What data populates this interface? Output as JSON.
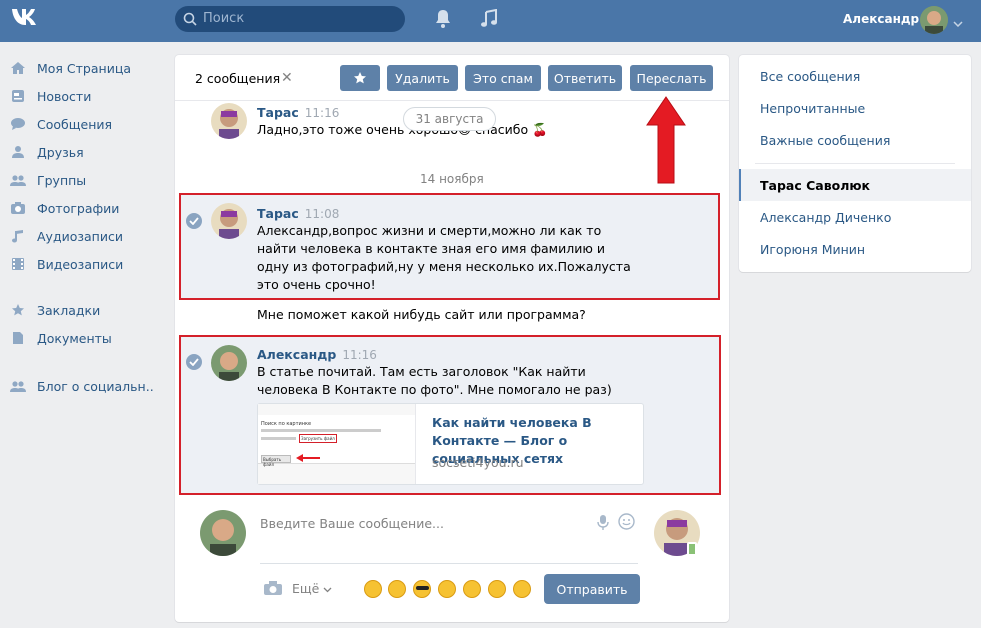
{
  "header": {
    "search_placeholder": "Поиск",
    "user_name": "Александр"
  },
  "sidebar": {
    "items": [
      {
        "label": "Моя Страница",
        "icon": "home-icon"
      },
      {
        "label": "Новости",
        "icon": "news-icon"
      },
      {
        "label": "Сообщения",
        "icon": "messages-icon"
      },
      {
        "label": "Друзья",
        "icon": "friends-icon"
      },
      {
        "label": "Группы",
        "icon": "groups-icon"
      },
      {
        "label": "Фотографии",
        "icon": "camera-icon"
      },
      {
        "label": "Аудиозаписи",
        "icon": "music-icon"
      },
      {
        "label": "Видеозаписи",
        "icon": "video-icon"
      },
      {
        "label": "Закладки",
        "icon": "star-icon"
      },
      {
        "label": "Документы",
        "icon": "document-icon"
      },
      {
        "label": "Блог о социальн..",
        "icon": "group-avatar-icon"
      }
    ]
  },
  "toolbar": {
    "selected_count": "2 сообщения",
    "delete": "Удалить",
    "spam": "Это спам",
    "reply": "Ответить",
    "forward": "Переслать"
  },
  "messages": [
    {
      "author": "Тарас",
      "time": "11:16",
      "text": "Ладно,это тоже очень хорошо😊 спасибо 🍒"
    },
    {
      "author": "Тарас",
      "time": "11:08",
      "text": "Александр,вопрос жизни и смерти,можно ли как то найти человека в контакте зная его имя фамилию и одну из фотографий,ну у меня несколько их.Пожалуста это очень срочно!"
    },
    {
      "text": "Мне поможет какой нибудь сайт или программа?"
    },
    {
      "author": "Александр",
      "time": "11:16",
      "text": "В статье почитай. Там есть заголовок \"Как найти человека В Контакте по фото\". Мне помогало не раз)"
    }
  ],
  "date_separators": {
    "top": "31 августа",
    "middle": "14 ноября"
  },
  "link_card": {
    "title": "Как найти человека В Контакте — Блог о социальных сетях",
    "domain": "socseti4you.ru",
    "thumb_heading": "Поиск по картинке",
    "thumb_button": "Выбрать файл",
    "thumb_upload": "Загрузить файл"
  },
  "right_menu": {
    "items": [
      "Все сообщения",
      "Непрочитанные",
      "Важные сообщения"
    ],
    "dialogs": [
      "Тарас Саволюк",
      "Александр Диченко",
      "Игорюня Минин"
    ],
    "active": "Тарас Саволюк"
  },
  "composer": {
    "placeholder": "Введите Ваше сообщение...",
    "more": "Ещё",
    "send": "Отправить"
  },
  "colors": {
    "header": "#4a76a8",
    "button": "#5e81a8",
    "highlight_border": "#d4202a",
    "link": "#2a5885"
  }
}
